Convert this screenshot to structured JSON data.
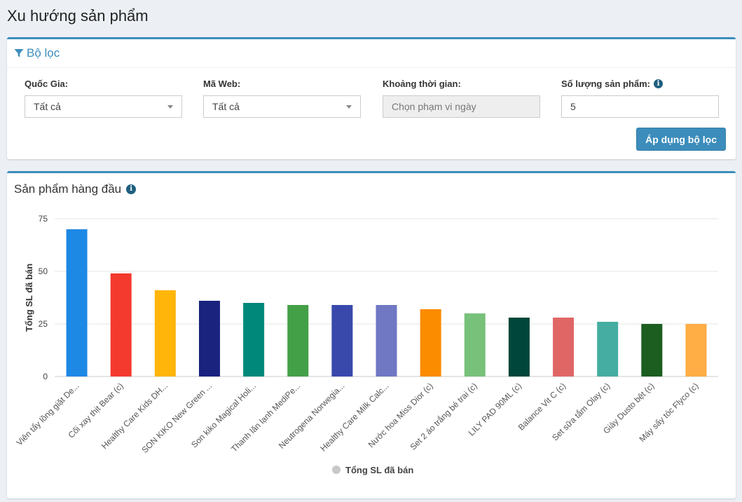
{
  "page": {
    "title": "Xu hướng sản phẩm"
  },
  "filter": {
    "title": "Bộ lọc",
    "country": {
      "label": "Quốc Gia:",
      "value": "Tất cả"
    },
    "web": {
      "label": "Mã Web:",
      "value": "Tất cả"
    },
    "period": {
      "label": "Khoảng thời gian:",
      "placeholder": "Chọn phạm vi ngày"
    },
    "count": {
      "label": "Số lượng sản phẩm:",
      "value": "5"
    },
    "apply_label": "Áp dụng bộ lọc"
  },
  "chart_box": {
    "title": "Sản phẩm hàng đầu"
  },
  "chart_data": {
    "type": "bar",
    "ylabel": "Tổng SL đã bán",
    "ylim": [
      0,
      75
    ],
    "yticks": [
      0,
      25,
      50,
      75
    ],
    "legend": "Tổng SL đã bán",
    "legend_position": "bottom",
    "grid": true,
    "categories": [
      "Viên tẩy lồng giặt De...",
      "Cối xay thịt Bear (c)",
      "Healthy Care Kids DH...",
      "SON KIKO New Green ...",
      "Son kiko Magical Holi...",
      "Thanh lăn lạnh MediPe...",
      "Neutrogena Norwegia...",
      "Healthy Care Milk Calc...",
      "Nước hoa Miss Dior (c)",
      "Set 2 áo trắng bé trai (c)",
      "LILY PAD 90ML (c)",
      "Balance Vit C (c)",
      "Set sữa tắm Olay (c)",
      "Giày Dusto bệt (c)",
      "Máy sấy tóc Flyco (c)"
    ],
    "values": [
      70,
      49,
      41,
      36,
      35,
      34,
      34,
      34,
      32,
      30,
      28,
      28,
      26,
      25,
      25
    ],
    "colors": [
      "#1e88e5",
      "#f4392e",
      "#ffb50a",
      "#1a237e",
      "#00897b",
      "#43a047",
      "#3949ab",
      "#7078c4",
      "#fb8c00",
      "#78c17a",
      "#00463a",
      "#e06666",
      "#45ada1",
      "#1b5e20",
      "#ffad45"
    ],
    "legend_color": "#c8c8c8"
  }
}
